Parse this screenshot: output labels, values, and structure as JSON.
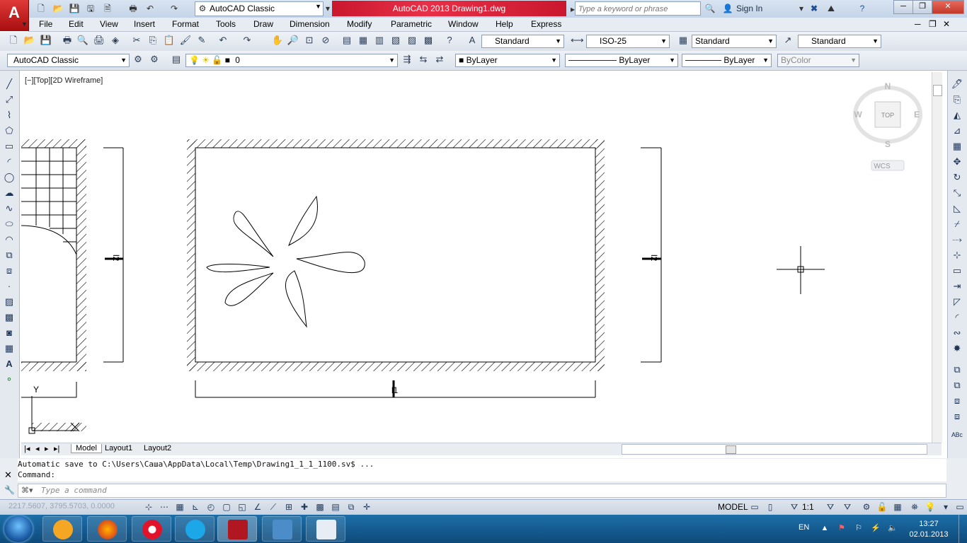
{
  "titlebar": {
    "workspace": "AutoCAD Classic",
    "title": "AutoCAD 2013    Drawing1.dwg",
    "search_placeholder": "Type a keyword or phrase",
    "sign_in": "Sign In"
  },
  "menu": [
    "File",
    "Edit",
    "View",
    "Insert",
    "Format",
    "Tools",
    "Draw",
    "Dimension",
    "Modify",
    "Parametric",
    "Window",
    "Help",
    "Express"
  ],
  "styles_toolbar": {
    "text_style": "Standard",
    "dim_style": "ISO-25",
    "table_style": "Standard",
    "mleader_style": "Standard"
  },
  "layers_toolbar": {
    "workspace": "AutoCAD Classic",
    "layer": "0",
    "color": "ByLayer",
    "linetype": "ByLayer",
    "lineweight": "ByLayer",
    "plotstyle": "ByColor"
  },
  "viewport": {
    "label": "[−][Top][2D Wireframe]",
    "viewcube": {
      "north": "N",
      "south": "S",
      "east": "E",
      "west": "W",
      "face": "TOP",
      "wcs": "WCS"
    },
    "ucs_y": "Y"
  },
  "dimensions": {
    "l2_left": "l2",
    "l2_right": "l2",
    "l1": "l1"
  },
  "tabs": [
    "Model",
    "Layout1",
    "Layout2"
  ],
  "command": {
    "history_line1": "Automatic save to C:\\Users\\Саша\\AppData\\Local\\Temp\\Drawing1_1_1_1100.sv$ ...",
    "history_line2": "Command:",
    "input_placeholder": "Type a command"
  },
  "status": {
    "coords": "2217.5607, 3795.5703, 0.0000",
    "model": "MODEL",
    "scale": "1:1"
  },
  "tray": {
    "lang": "EN",
    "time": "13:27",
    "date": "02.01.2013"
  },
  "colors": {
    "title_accent": "#d0213a",
    "logo_red": "#c41a1a",
    "taskbar": "#165c92"
  }
}
